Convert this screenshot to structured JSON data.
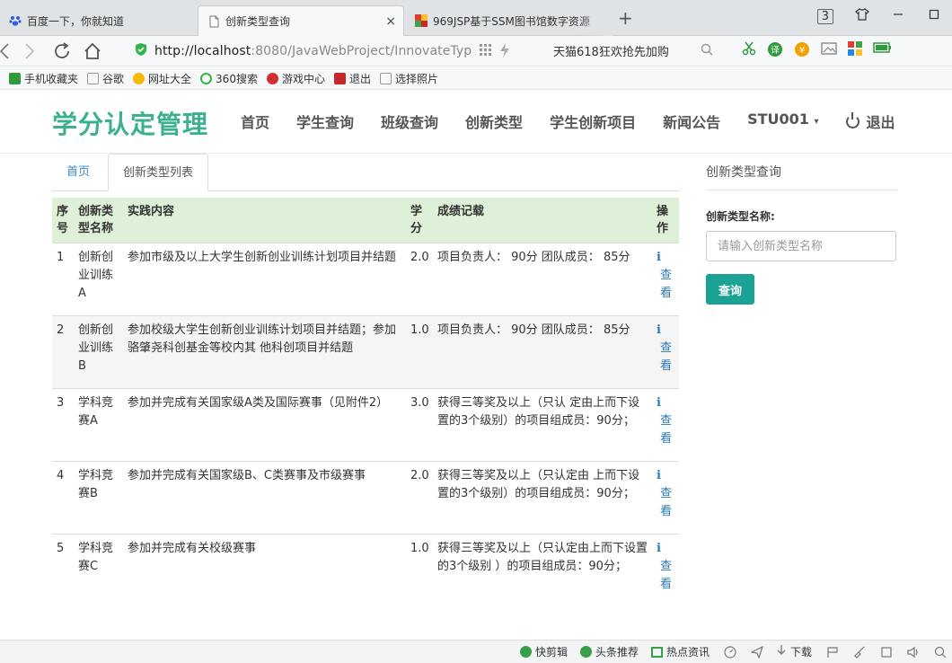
{
  "browser": {
    "tabs": [
      {
        "title": "百度一下，你就知道",
        "icon": "paw-icon"
      },
      {
        "title": "创新类型查询",
        "icon": "page-icon",
        "close": "×"
      },
      {
        "title": "969JSP基于SSM图书馆数字资源",
        "icon": "site-icon"
      }
    ],
    "new_tab": "+",
    "tab_count": "3",
    "url_host": "http://localhost",
    "url_rest": ":8080/JavaWebProject/InnovateTyp",
    "promo_text": "天猫618狂欢抢先加购"
  },
  "bookmarks": [
    "手机收藏夹",
    "谷歌",
    "网址大全",
    "360搜索",
    "游戏中心",
    "退出",
    "选择照片"
  ],
  "header": {
    "brand": "学分认定管理",
    "nav": [
      "首页",
      "学生查询",
      "班级查询",
      "创新类型",
      "学生创新项目",
      "新闻公告"
    ],
    "user": "STU001",
    "user_caret": "▾",
    "logout": "退出"
  },
  "breadcrumb": {
    "home": "首页",
    "current": "创新类型列表"
  },
  "table": {
    "headers": [
      "序号",
      "创新类型名称",
      "实践内容",
      "学分",
      "成绩记载",
      "操作"
    ],
    "rows": [
      {
        "no": "1",
        "name": "创新创业训练A",
        "content": "参加市级及以上大学生创新创业训练计划项目并结题",
        "credit": "2.0",
        "record": "项目负责人： 90分 团队成员： 85分",
        "action": "查看"
      },
      {
        "no": "2",
        "name": "创新创业训练B",
        "content": "参加校级大学生创新创业训练计划项目并结题；参加骆肇尧科创基金等校内其 他科创项目并结题",
        "credit": "1.0",
        "record": "项目负责人： 90分 团队成员： 85分",
        "action": "查看"
      },
      {
        "no": "3",
        "name": "学科竞赛A",
        "content": "参加并完成有关国家级A类及国际赛事（见附件2）",
        "credit": "3.0",
        "record": "获得三等奖及以上（只认 定由上而下设置的3个级别）的项目组成员：90分；",
        "action": "查看"
      },
      {
        "no": "4",
        "name": "学科竞赛B",
        "content": "参加并完成有关国家级B、C类赛事及市级赛事",
        "credit": "2.0",
        "record": "获得三等奖及以上（只认定由 上而下设置的3个级别）的项目组成员：90分；",
        "action": "查看"
      },
      {
        "no": "5",
        "name": "学科竞赛C",
        "content": "参加并完成有关校级赛事",
        "credit": "1.0",
        "record": "获得三等奖及以上（只认定由上而下设置的3个级别 ）的项目组成员：90分；",
        "action": "查看"
      }
    ]
  },
  "sidebar": {
    "title": "创新类型查询",
    "label": "创新类型名称:",
    "placeholder": "请输入创新类型名称",
    "button": "查询"
  },
  "statusbar": [
    "快剪辑",
    "头条推荐",
    "热点资讯",
    "下载"
  ],
  "colors": {
    "brand": "#3cb08f",
    "table_header": "#dff0d8",
    "button": "#1aa394",
    "link": "#2a7ab8"
  }
}
